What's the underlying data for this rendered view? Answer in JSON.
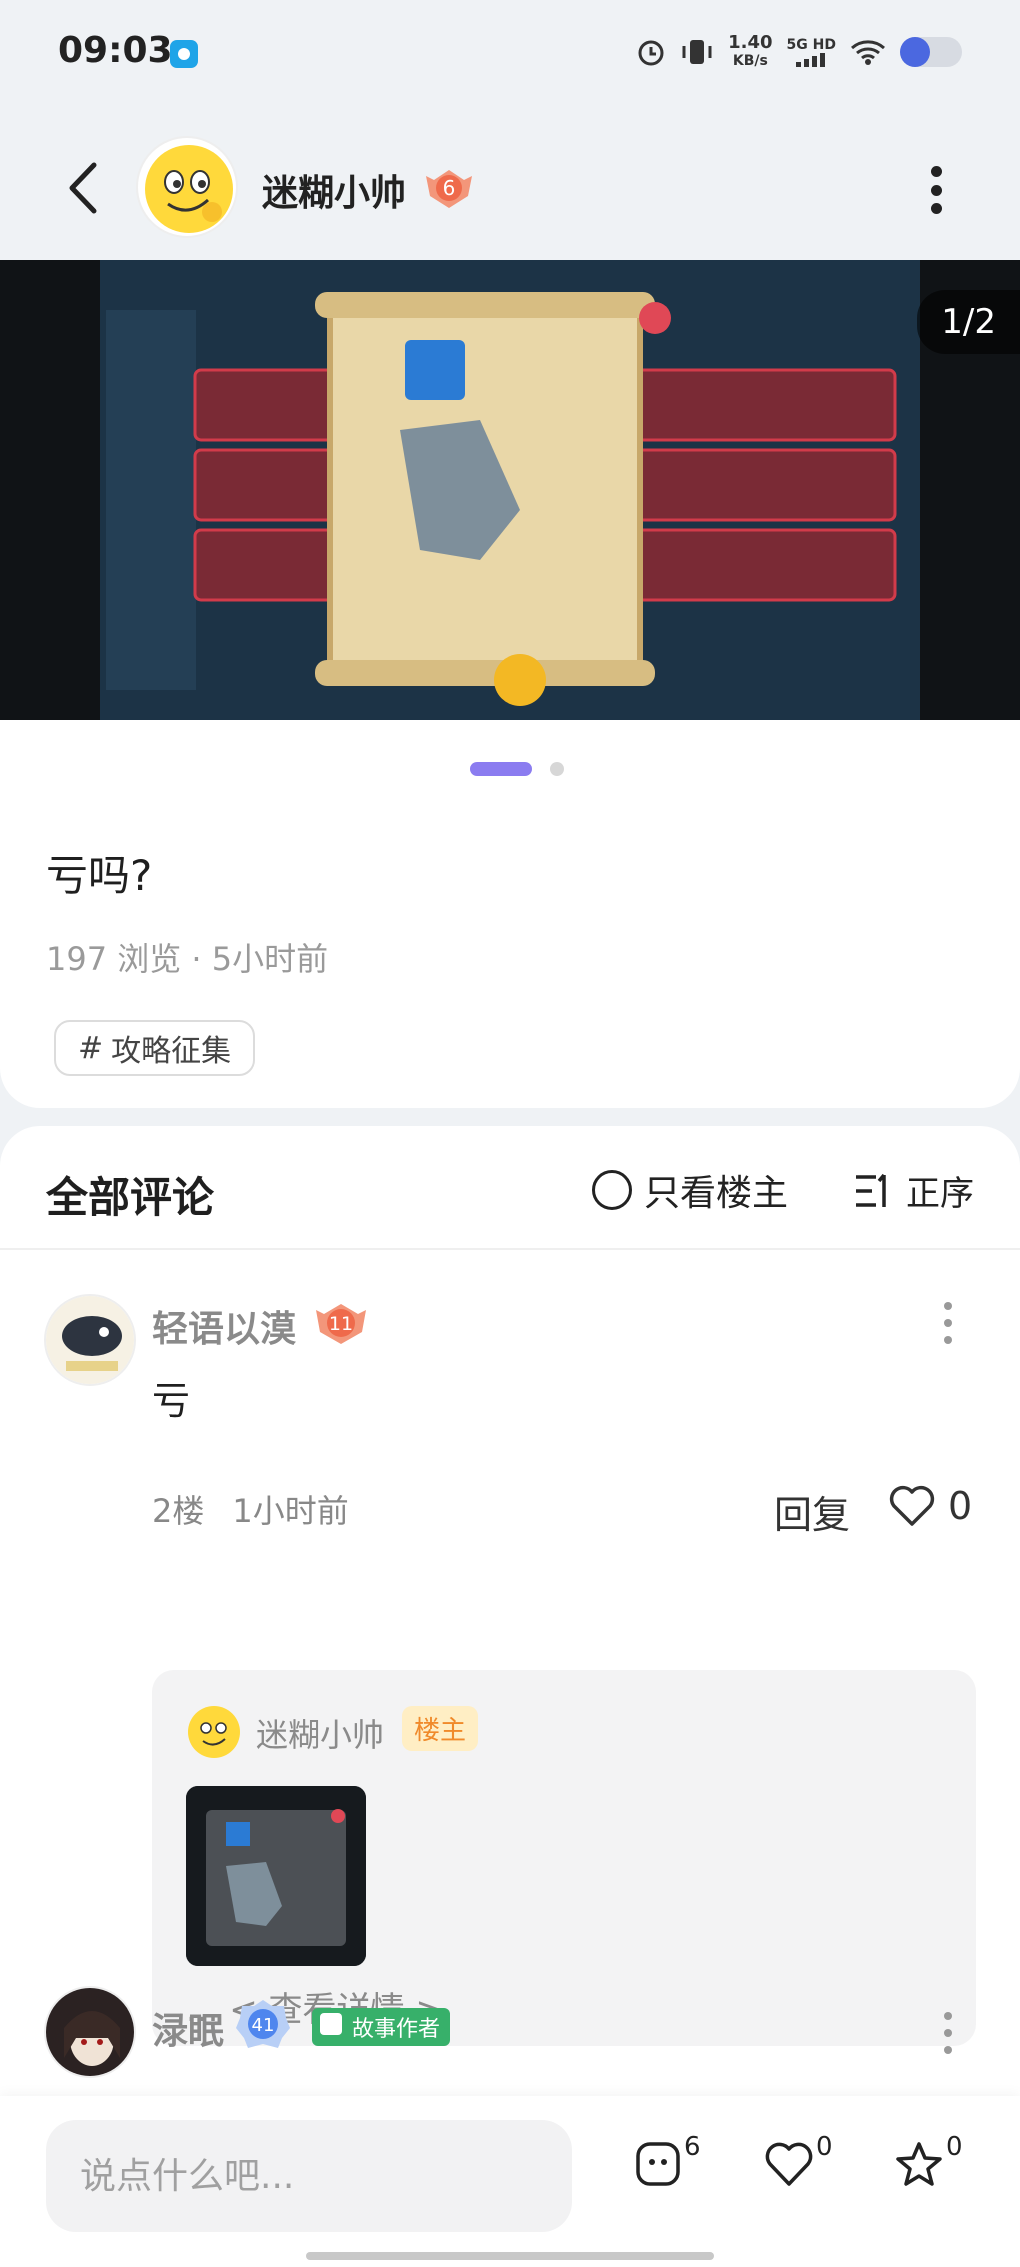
{
  "status_bar": {
    "time": "09:03",
    "speed_value": "1.40",
    "speed_unit": "KB/s",
    "network_label": "5G HD"
  },
  "header": {
    "author_name": "迷糊小帅",
    "author_level": "6"
  },
  "carousel": {
    "counter": "1/2",
    "active_index": 1,
    "total": 2
  },
  "post": {
    "title": "亏吗?",
    "meta": "197 浏览 · 5小时前",
    "tag_hash": "#",
    "tag": "攻略征集"
  },
  "comments": {
    "title": "全部评论",
    "only_op_label": "只看楼主",
    "sort_label": "正序",
    "items": [
      {
        "name": "轻语以漠",
        "level": "11",
        "text": "亏",
        "floor": "2楼",
        "time": "1小时前",
        "reply_label": "回复",
        "likes": "0",
        "reply": {
          "name": "迷糊小帅",
          "badge": "楼主",
          "see_detail": "... < 查看详情 >"
        }
      },
      {
        "name": "渌眠",
        "level": "41",
        "role_badge": "故事作者"
      }
    ]
  },
  "bottom_bar": {
    "input_placeholder": "说点什么吧...",
    "comment_count": "6",
    "like_count": "0",
    "favorite_count": "0"
  }
}
